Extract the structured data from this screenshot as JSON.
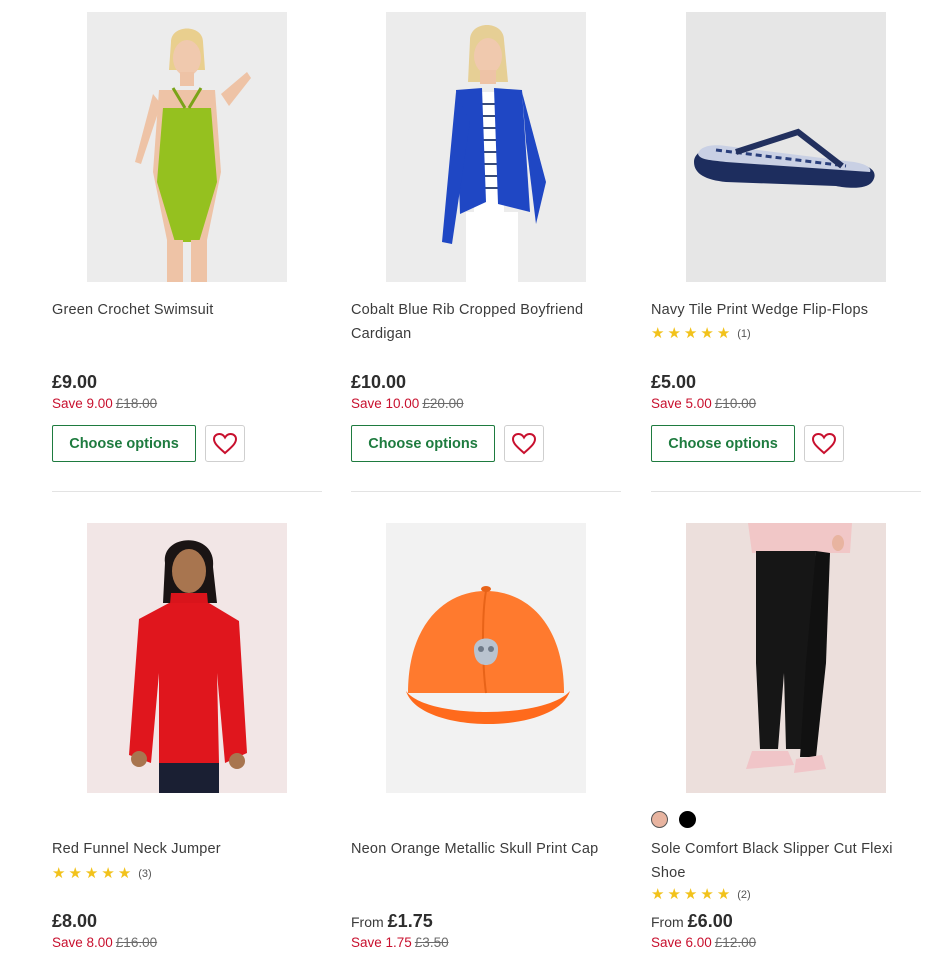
{
  "products": [
    {
      "title": "Green Crochet Swimsuit",
      "price": "£9.00",
      "save": "Save 9.00",
      "was": "£18.00",
      "button": "Choose options",
      "image": "green-crochet-swimsuit",
      "colors": {
        "bg": "#ececec"
      }
    },
    {
      "title": "Cobalt Blue Rib Cropped Boyfriend Cardigan",
      "price": "£10.00",
      "save": "Save 10.00",
      "was": "£20.00",
      "button": "Choose options",
      "image": "cobalt-blue-cardigan",
      "colors": {
        "bg": "#ececec"
      }
    },
    {
      "title": "Navy Tile Print Wedge Flip-Flops",
      "rating": 5,
      "rating_count": "(1)",
      "price": "£5.00",
      "save": "Save 5.00",
      "was": "£10.00",
      "button": "Choose options",
      "image": "navy-flip-flops",
      "colors": {
        "bg": "#e6e6e6"
      }
    },
    {
      "title": "Red Funnel Neck Jumper",
      "rating": 5,
      "rating_count": "(3)",
      "price": "£8.00",
      "save": "Save 8.00",
      "was": "£16.00",
      "image": "red-jumper",
      "colors": {
        "bg": "#f2e6e6"
      }
    },
    {
      "title": "Neon Orange Metallic Skull Print Cap",
      "from": "From",
      "price": "£1.75",
      "save": "Save 1.75",
      "was": "£3.50",
      "image": "orange-cap",
      "colors": {
        "bg": "#f2f2f2"
      }
    },
    {
      "title": "Sole Comfort Black Slipper Cut Flexi Shoe",
      "rating": 5,
      "rating_count": "(2)",
      "from": "From",
      "price": "£6.00",
      "save": "Save 6.00",
      "was": "£12.00",
      "image": "black-slipper-leggings",
      "swatches": [
        "nude",
        "black"
      ],
      "colors": {
        "bg": "#ecdfdc",
        "swatch_nude": "#e8b4a0",
        "swatch_black": "#000000"
      }
    }
  ],
  "theme": {
    "accent_green": "#1e7b3f",
    "sale_red": "#c8102e",
    "star_yellow": "#f2c21b",
    "heart_red": "#c8102e"
  }
}
